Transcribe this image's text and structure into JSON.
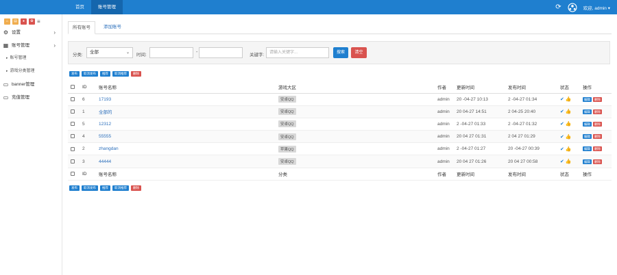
{
  "topbar": {
    "nav": [
      "首页",
      "账号管理"
    ],
    "welcome": "欢迎, admin ▾",
    "refresh_icon": "⟳"
  },
  "sidebar": {
    "menu": [
      {
        "icon": "⚙",
        "label": "设置",
        "chevron": "›"
      },
      {
        "icon": "▦",
        "label": "账号管理",
        "chevron": "›"
      }
    ],
    "sub": [
      "账号管理",
      "游戏分类管理"
    ],
    "menu2": [
      {
        "icon": "▭",
        "label": "banner管理"
      },
      {
        "icon": "▭",
        "label": "充值管理"
      }
    ]
  },
  "tabs": {
    "active": "所有账号",
    "add": "添加账号"
  },
  "filter": {
    "category_label": "分类:",
    "category_value": "全部",
    "time_label": "时间:",
    "dash": "-",
    "keyword_label": "关键字:",
    "keyword_placeholder": "请输入关键字...",
    "search": "搜索",
    "clear": "清空"
  },
  "actions": [
    "发布",
    "取消发布",
    "推荐",
    "取消推荐",
    "删除"
  ],
  "table": {
    "headers": [
      "ID",
      "账号名称",
      "游戏大区",
      "作者",
      "更新时间",
      "发布时间",
      "状态",
      "操作"
    ],
    "rows": [
      {
        "id": "6",
        "name": "17193",
        "region": "安卓QQ",
        "author": "admin",
        "updated": "20   -04-27 10:13",
        "published": "2   -04-27 01:34"
      },
      {
        "id": "1",
        "name": "全部的",
        "region": "安卓QQ",
        "author": "admin",
        "updated": "20   04-27 14:51",
        "published": "2   04-25 20:40"
      },
      {
        "id": "5",
        "name": "12312",
        "region": "安卓QQ",
        "author": "admin",
        "updated": "2   -04-27 01:33",
        "published": "2   -04-27 01:32"
      },
      {
        "id": "4",
        "name": "55555",
        "region": "安卓QQ",
        "author": "admin",
        "updated": "20   04 27 01:31",
        "published": "2   04 27 01:29"
      },
      {
        "id": "2",
        "name": "zhangdan",
        "region": "苹果QQ",
        "author": "admin",
        "updated": "2   -04-27 01:27",
        "published": "20   -04-27 00:39"
      },
      {
        "id": "3",
        "name": "44444",
        "region": "安卓QQ",
        "author": "admin",
        "updated": "20   04 27 01:26",
        "published": "20   04 27 00:58"
      }
    ],
    "status_icons": "✔ 👍",
    "edit": "编辑",
    "delete": "删除"
  },
  "footer_headers": [
    "ID",
    "账号名称",
    "分类",
    "作者",
    "更新时间",
    "发布时间",
    "状态",
    "操作"
  ],
  "colors": {
    "primary": "#1f7fcf",
    "danger": "#d9534f"
  }
}
